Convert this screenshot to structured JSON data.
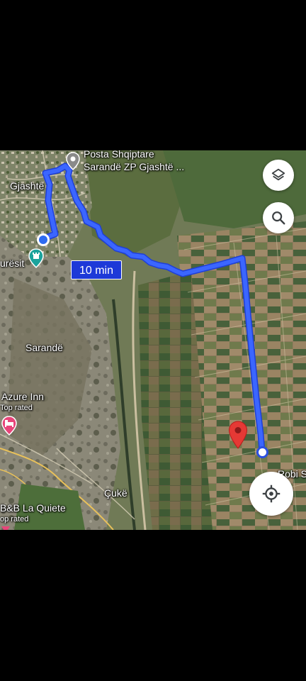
{
  "map": {
    "route_duration": "10 min",
    "place_labels": {
      "gjashte": "Gjashtë",
      "urresit": "urësit",
      "sarande": "Sarandë",
      "azure_inn": "Azure Inn",
      "azure_inn_badge": "Top rated",
      "b_and_b": "B&B La Quiete",
      "b_and_b_badge": "op rated",
      "cuke": "Çukë",
      "robi": "Robi S"
    },
    "poi_post": {
      "line1": "Posta Shqiptare",
      "line2": "Sarandë ZP Gjashtë ..."
    },
    "controls": {
      "layers_icon": "layers-icon",
      "search_icon": "search-icon",
      "locate_icon": "my-location-icon"
    },
    "colors": {
      "route": "#2d55f0",
      "badge": "#1d39d8",
      "destination_pin": "#e53935"
    }
  }
}
